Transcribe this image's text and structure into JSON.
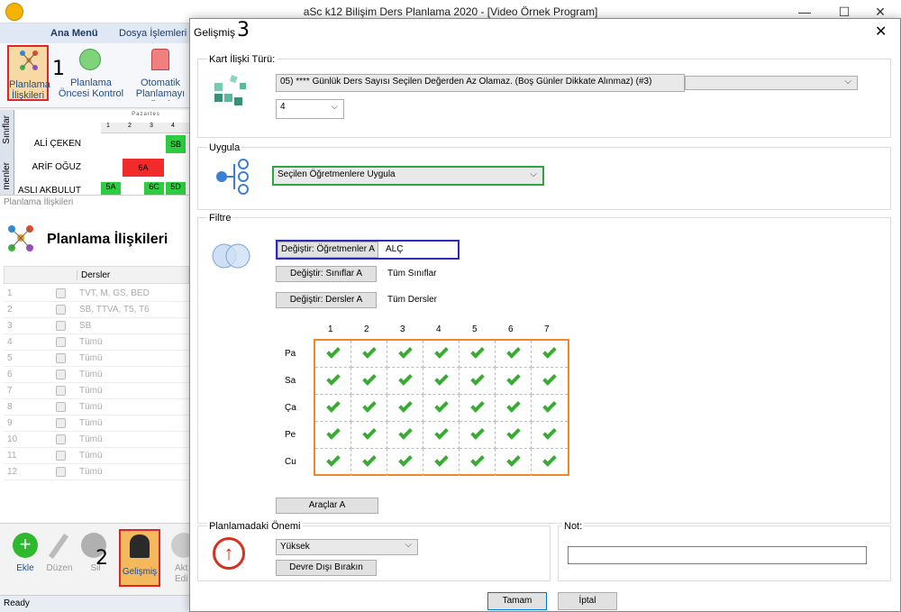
{
  "app": {
    "title": "aSc k12 Bilişim Ders Planlama 2020  - [Video Örnek Program]",
    "status": "Ready"
  },
  "ribbon": {
    "tabs": [
      "Ana Menü",
      "Dosya İşlemleri"
    ],
    "buttons": [
      {
        "label1": "Planlama",
        "label2": "İlişkileri"
      },
      {
        "label1": "Planlama",
        "label2": "Öncesi Kontrol"
      },
      {
        "label1": "Otomatik",
        "label2": "Planlamayı Başl"
      }
    ],
    "annotation1": "1"
  },
  "timetable": {
    "header": "Pazartes",
    "periods": [
      "1",
      "2",
      "3",
      "4"
    ],
    "side_tabs": [
      "Sınıflar",
      "menler"
    ],
    "rows": [
      {
        "name": "ALİ ÇEKEN",
        "cells": [
          {
            "text": "SB",
            "col": 4,
            "color": "#2ecc40"
          }
        ]
      },
      {
        "name": "ARİF OĞUZ",
        "cells": [
          {
            "text": "6A",
            "col": 2,
            "color": "#f22a2a"
          }
        ]
      },
      {
        "name": "ASLI AKBULUT",
        "cells": [
          {
            "text": "5A",
            "col": 1,
            "color": "#2ecc40"
          },
          {
            "text": "6C",
            "col": 3,
            "color": "#2ecc40"
          },
          {
            "text": "5D",
            "col": 4,
            "color": "#2ecc40"
          }
        ]
      }
    ]
  },
  "planlama_panel": {
    "caption": "Planlama İlişkileri",
    "title": "Planlama İlişkileri",
    "column_header": "Dersler",
    "rows": [
      {
        "num": "1",
        "val": "TVT, M, GS, BED"
      },
      {
        "num": "2",
        "val": "SB, TTVA, T5, T6"
      },
      {
        "num": "3",
        "val": "SB"
      },
      {
        "num": "4",
        "val": "Tümü"
      },
      {
        "num": "5",
        "val": "Tümü"
      },
      {
        "num": "6",
        "val": "Tümü"
      },
      {
        "num": "7",
        "val": "Tümü"
      },
      {
        "num": "8",
        "val": "Tümü"
      },
      {
        "num": "9",
        "val": "Tümü"
      },
      {
        "num": "10",
        "val": "Tümü"
      },
      {
        "num": "11",
        "val": "Tümü"
      },
      {
        "num": "12",
        "val": "Tümü"
      }
    ],
    "toolbar": {
      "add": "Ekle",
      "edit": "Düzen",
      "delete": "Sil",
      "advanced": "Gelişmiş",
      "active1": "Akt",
      "active2": "Edi"
    },
    "annotation2": "2"
  },
  "dialog": {
    "title": "Gelişmiş",
    "annotation3": "3",
    "close": "✕",
    "kart": {
      "label": "Kart İlişki Türü:",
      "type_value": "05) **** Günlük Ders Sayısı Seçilen Değerden Az Olamaz. (Boş Günler Dikkate Alınmaz) (#3)",
      "number_value": "4"
    },
    "uygula": {
      "label": "Uygula",
      "value": "Seçilen Öğretmenlere Uygula"
    },
    "filtre": {
      "label": "Filtre",
      "teachers_button": "Değiştir: Öğretmenler A",
      "teachers_value": "ALÇ",
      "classes_button": "Değiştir: Sınıflar A",
      "classes_value": "Tüm Sınıflar",
      "lessons_button": "Değiştir: Dersler A",
      "lessons_value": "Tüm Dersler",
      "periods": [
        "1",
        "2",
        "3",
        "4",
        "5",
        "6",
        "7"
      ],
      "days": [
        "Pa",
        "Sa",
        "Ça",
        "Pe",
        "Cu"
      ],
      "tools_button": "Araçlar A"
    },
    "onem": {
      "label": "Planlamadaki Önemi",
      "value": "Yüksek",
      "disable_button": "Devre Dışı Bırakın"
    },
    "not": {
      "label": "Not:",
      "value": ""
    },
    "ok": "Tamam",
    "cancel": "İptal"
  },
  "colors": {
    "red_highlight": "#e0262b",
    "green_highlight": "#2fa344",
    "blue_highlight": "#2b2bb8",
    "orange_highlight": "#f0882b",
    "check_green": "#3aaa35"
  }
}
